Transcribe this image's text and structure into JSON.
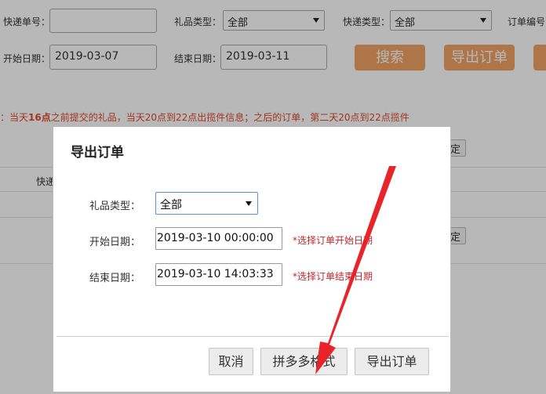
{
  "filters": {
    "tracking_no_label": "快递单号：",
    "tracking_no_value": "",
    "gift_type_label": "礼品类型：",
    "gift_type_value": "全部",
    "express_type_label": "快递类型：",
    "express_type_value": "全部",
    "order_no_label": "订单编号",
    "start_date_label": "开始日期：",
    "start_date_value": "2019-03-07",
    "end_date_label": "结束日期：",
    "end_date_value": "2019-03-11",
    "search_label": "搜索",
    "export_label": "导出订单"
  },
  "notice": {
    "pre": "：当天",
    "bold": "16点",
    "post": "之前提交的礼品，当天20点到22点出揽件信息；之后的订单，第二天20点到22点揽件"
  },
  "table": {
    "col_header": "快递",
    "confirm_label_1": "定",
    "confirm_label_2": "定"
  },
  "modal": {
    "title": "导出订单",
    "gift_type_label": "礼品类型：",
    "gift_type_value": "全部",
    "start_label": "开始日期：",
    "start_value": "2019-03-10 00:00:00",
    "start_hint": "*选择订单开始日期",
    "end_label": "结束日期：",
    "end_value": "2019-03-10 14:03:33",
    "end_hint": "*选择订单结束日期",
    "cancel_label": "取消",
    "pdd_label": "拼多多格式",
    "export_label": "导出订单"
  },
  "colors": {
    "accent_orange": "#f0a264",
    "notice_red": "#e04a2f",
    "hint_red": "#c0262d",
    "arrow_red": "#e8242a"
  }
}
